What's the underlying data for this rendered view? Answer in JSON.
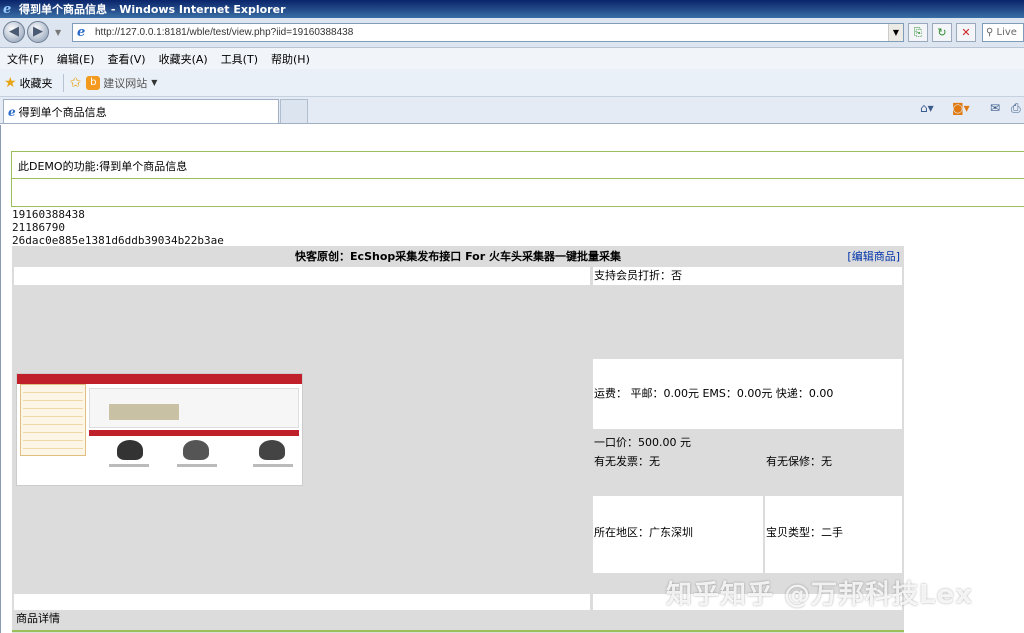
{
  "window": {
    "title": "得到单个商品信息 - Windows Internet Explorer"
  },
  "address": {
    "url": "http://127.0.0.1:8181/wble/test/view.php?iid=19160388438"
  },
  "search": {
    "placeholder": "Live"
  },
  "menu": [
    "文件(F)",
    "编辑(E)",
    "查看(V)",
    "收藏夹(A)",
    "工具(T)",
    "帮助(H)"
  ],
  "favorites": {
    "label": "收藏夹",
    "suggest": "建议网站"
  },
  "tab": {
    "label": "得到单个商品信息"
  },
  "demo": {
    "text": "此DEMO的功能:得到单个商品信息"
  },
  "ids": [
    "19160388438",
    "21186790",
    "26dac0e885e1381d6ddb39034b22b3ae"
  ],
  "goods": {
    "title": "快客原创：EcShop采集发布接口 For 火车头采集器一键批量采集",
    "edit": "[编辑商品]",
    "member_discount": "支持会员打折：否",
    "price": "一口价：500.00   元",
    "shipping": "运费：  平邮：0.00元  EMS：0.00元   快递：0.00",
    "invoice": "有无发票：无",
    "warranty": "有无保修：无",
    "location": "所在地区：广东深圳",
    "item_type": "宝贝类型：二手",
    "detail_label": "商品详情"
  },
  "watermark": "知乎知乎 @万邦科技Lex"
}
